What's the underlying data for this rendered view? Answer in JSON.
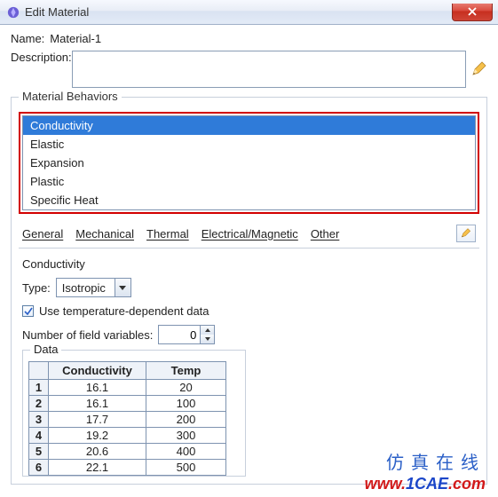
{
  "window": {
    "title": "Edit Material"
  },
  "fields": {
    "name_label": "Name:",
    "name_value": "Material-1",
    "description_label": "Description:"
  },
  "behaviors": {
    "legend": "Material Behaviors",
    "items": [
      "Conductivity",
      "Elastic",
      "Expansion",
      "Plastic",
      "Specific Heat"
    ],
    "selected_index": 0
  },
  "menus": {
    "general": "General",
    "mechanical": "Mechanical",
    "thermal": "Thermal",
    "electrical": "Electrical/Magnetic",
    "other": "Other"
  },
  "conductivity": {
    "title": "Conductivity",
    "type_label": "Type:",
    "type_value": "Isotropic",
    "use_temp_label": "Use temperature-dependent data",
    "use_temp_checked": true,
    "field_vars_label": "Number of field variables:",
    "field_vars_value": "0",
    "data_legend": "Data",
    "columns": {
      "conductivity": "Conductivity",
      "temp": "Temp"
    }
  },
  "chart_data": {
    "type": "table",
    "title": "Conductivity Data",
    "columns": [
      "Conductivity",
      "Temp"
    ],
    "rows": [
      {
        "n": "1",
        "c": "16.1",
        "t": "20"
      },
      {
        "n": "2",
        "c": "16.1",
        "t": "100"
      },
      {
        "n": "3",
        "c": "17.7",
        "t": "200"
      },
      {
        "n": "4",
        "c": "19.2",
        "t": "300"
      },
      {
        "n": "5",
        "c": "20.6",
        "t": "400"
      },
      {
        "n": "6",
        "c": "22.1",
        "t": "500"
      }
    ]
  },
  "watermark": {
    "cn": "仿真在线",
    "url_pre": "www.",
    "url_mid": "1CAE",
    "url_suf": ".com"
  }
}
